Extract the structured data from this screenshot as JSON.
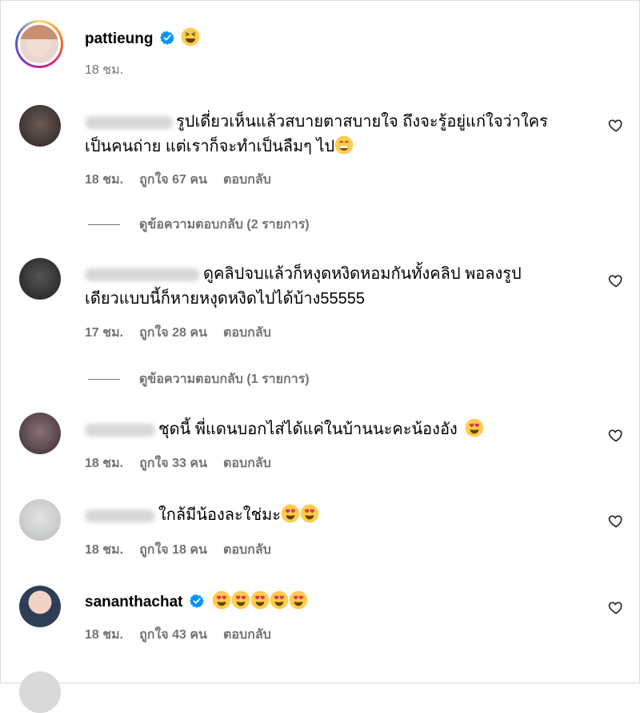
{
  "post": {
    "username": "pattieung",
    "time": "18 ชม."
  },
  "comments": [
    {
      "text_line1": "รูปเดี่ยวเห็นแล้วสบายตาสบายใจ ถึงจะรู้อยู่แก่ใจว่าใคร",
      "text_line2": "เป็นคนถ่าย แต่เราก็จะทำเป็นลืมๆ ไป",
      "time": "18 ชม.",
      "likes": "ถูกใจ 67 คน",
      "reply": "ตอบกลับ",
      "view_replies": "ดูข้อความตอบกลับ (2 รายการ)"
    },
    {
      "text_line1": "ดูคลิปจบแล้วก็หงุดหงิดหอมกันทั้งคลิป พอลงรูป",
      "text_line2": "เดียวแบบนี้ก็หายหงุดหงิดไปได้บ้าง55555",
      "time": "17 ชม.",
      "likes": "ถูกใจ 28 คน",
      "reply": "ตอบกลับ",
      "view_replies": "ดูข้อความตอบกลับ (1 รายการ)"
    },
    {
      "text_line1": "ชุดนี้ พี่แดนบอกไส่ได้แค่ในบ้านนะคะน้องอัง",
      "time": "18 ชม.",
      "likes": "ถูกใจ 33 คน",
      "reply": "ตอบกลับ"
    },
    {
      "text_line1": "ใกล้มีน้องละใช่มะ",
      "time": "18 ชม.",
      "likes": "ถูกใจ 18 คน",
      "reply": "ตอบกลับ"
    },
    {
      "username": "sananthachat",
      "time": "18 ชม.",
      "likes": "ถูกใจ 43 คน",
      "reply": "ตอบกลับ"
    }
  ],
  "colors": {
    "verified": "#0095f6",
    "meta": "#737373"
  },
  "icons": [
    "verified-badge-icon",
    "squinting-face-emoji",
    "grinning-face-emoji",
    "heart-eyes-emoji",
    "heart-outline-icon"
  ]
}
